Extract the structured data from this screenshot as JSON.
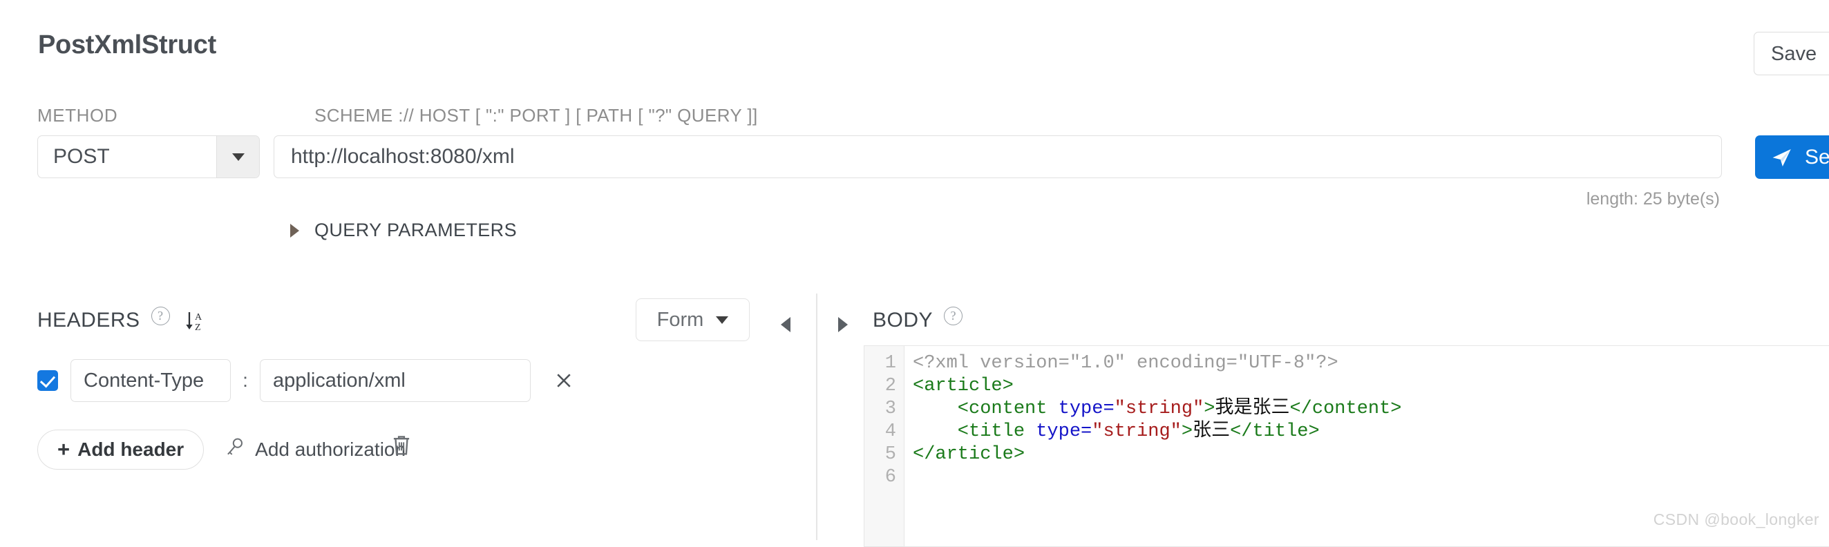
{
  "header": {
    "title": "PostXmlStruct",
    "save_label": "Save"
  },
  "request": {
    "method_label": "METHOD",
    "method_value": "POST",
    "url_label": "SCHEME :// HOST [ \":\" PORT ] [ PATH [ \"?\" QUERY ]]",
    "url_value": "http://localhost:8080/xml",
    "send_label": "Send",
    "length_info": "length: 25 byte(s)",
    "query_params_label": "QUERY PARAMETERS"
  },
  "headers_panel": {
    "title": "HEADERS",
    "view_mode": "Form",
    "rows": [
      {
        "enabled": true,
        "key": "Content-Type",
        "separator": ":",
        "value": "application/xml"
      }
    ],
    "add_header_label": "Add header",
    "add_header_plus": "+",
    "add_authorization_label": "Add authorization"
  },
  "body_panel": {
    "title": "BODY",
    "line_numbers": [
      "1",
      "2",
      "3",
      "4",
      "5",
      "6"
    ],
    "code_lines": [
      {
        "segments": [
          {
            "text": "<?xml version=\"1.0\" encoding=\"UTF-8\"?>",
            "type": "decl"
          }
        ]
      },
      {
        "segments": [
          {
            "text": "<article>",
            "type": "tag"
          }
        ]
      },
      {
        "segments": [
          {
            "text": "    <content ",
            "type": "tag"
          },
          {
            "text": "type=",
            "type": "attr"
          },
          {
            "text": "\"string\"",
            "type": "str"
          },
          {
            "text": ">",
            "type": "tag"
          },
          {
            "text": "我是张三",
            "type": "text"
          },
          {
            "text": "</content>",
            "type": "tag"
          }
        ]
      },
      {
        "segments": [
          {
            "text": "    <title ",
            "type": "tag"
          },
          {
            "text": "type=",
            "type": "attr"
          },
          {
            "text": "\"string\"",
            "type": "str"
          },
          {
            "text": ">",
            "type": "tag"
          },
          {
            "text": "张三",
            "type": "text"
          },
          {
            "text": "</title>",
            "type": "tag"
          }
        ]
      },
      {
        "segments": [
          {
            "text": "</article>",
            "type": "tag"
          }
        ]
      },
      {
        "segments": [
          {
            "text": "",
            "type": "tag"
          }
        ]
      }
    ]
  },
  "watermark": "CSDN @book_longker",
  "colors": {
    "accent_blue": "#0b76da",
    "checkbox_blue": "#1478e0",
    "label_gray": "#8d8d8d",
    "text_dark": "#3a3f44"
  }
}
